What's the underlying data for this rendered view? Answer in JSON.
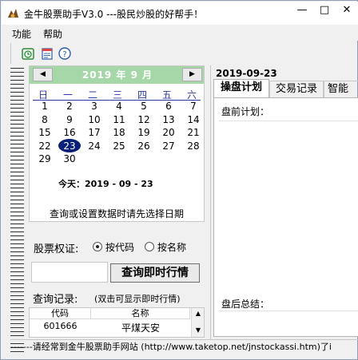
{
  "window": {
    "title": "金牛股票助手V3.0 ---股民炒股的好帮手！"
  },
  "menu": [
    "功能",
    "帮助"
  ],
  "toolbar": [
    "clock-icon",
    "note-icon",
    "help-icon"
  ],
  "calendar": {
    "title": "2019 年 9 月",
    "prev": "◀",
    "next": "▶",
    "weekdays": [
      "日",
      "一",
      "二",
      "三",
      "四",
      "五",
      "六"
    ],
    "weeks": [
      [
        "1",
        "2",
        "3",
        "4",
        "5",
        "6",
        "7"
      ],
      [
        "8",
        "9",
        "10",
        "11",
        "12",
        "13",
        "14"
      ],
      [
        "15",
        "16",
        "17",
        "18",
        "19",
        "20",
        "21"
      ],
      [
        "22",
        "23",
        "24",
        "25",
        "26",
        "27",
        "28"
      ],
      [
        "29",
        "30",
        "",
        "",
        "",
        "",
        ""
      ]
    ],
    "selected": "23",
    "today_text": "今天：2019 - 09 - 23",
    "hint": "查询或设置数据时请先选择日期"
  },
  "stock": {
    "label": "股票权证:",
    "option_code": "按代码",
    "option_name": "按名称",
    "selected_option": "按代码",
    "input_value": "",
    "query_button": "查询即时行情"
  },
  "records": {
    "label": "查询记录:",
    "sublabel": "(双击可显示即时行情)",
    "columns": [
      "代码",
      "名称"
    ],
    "rows": [
      {
        "code": "601666",
        "name": "平煤天安"
      }
    ]
  },
  "right": {
    "date": "2019-09-23",
    "tabs": [
      "操盘计划",
      "交易记录",
      "智能"
    ],
    "active_tab": "操盘计划",
    "pre_label": "盘前计划：",
    "pre_text": "",
    "post_label": "盘后总结：",
    "post_text": ""
  },
  "status": "-------请经常到金牛股票助手网站 (http://www.taketop.net/jnstockassi.htm)了i"
}
